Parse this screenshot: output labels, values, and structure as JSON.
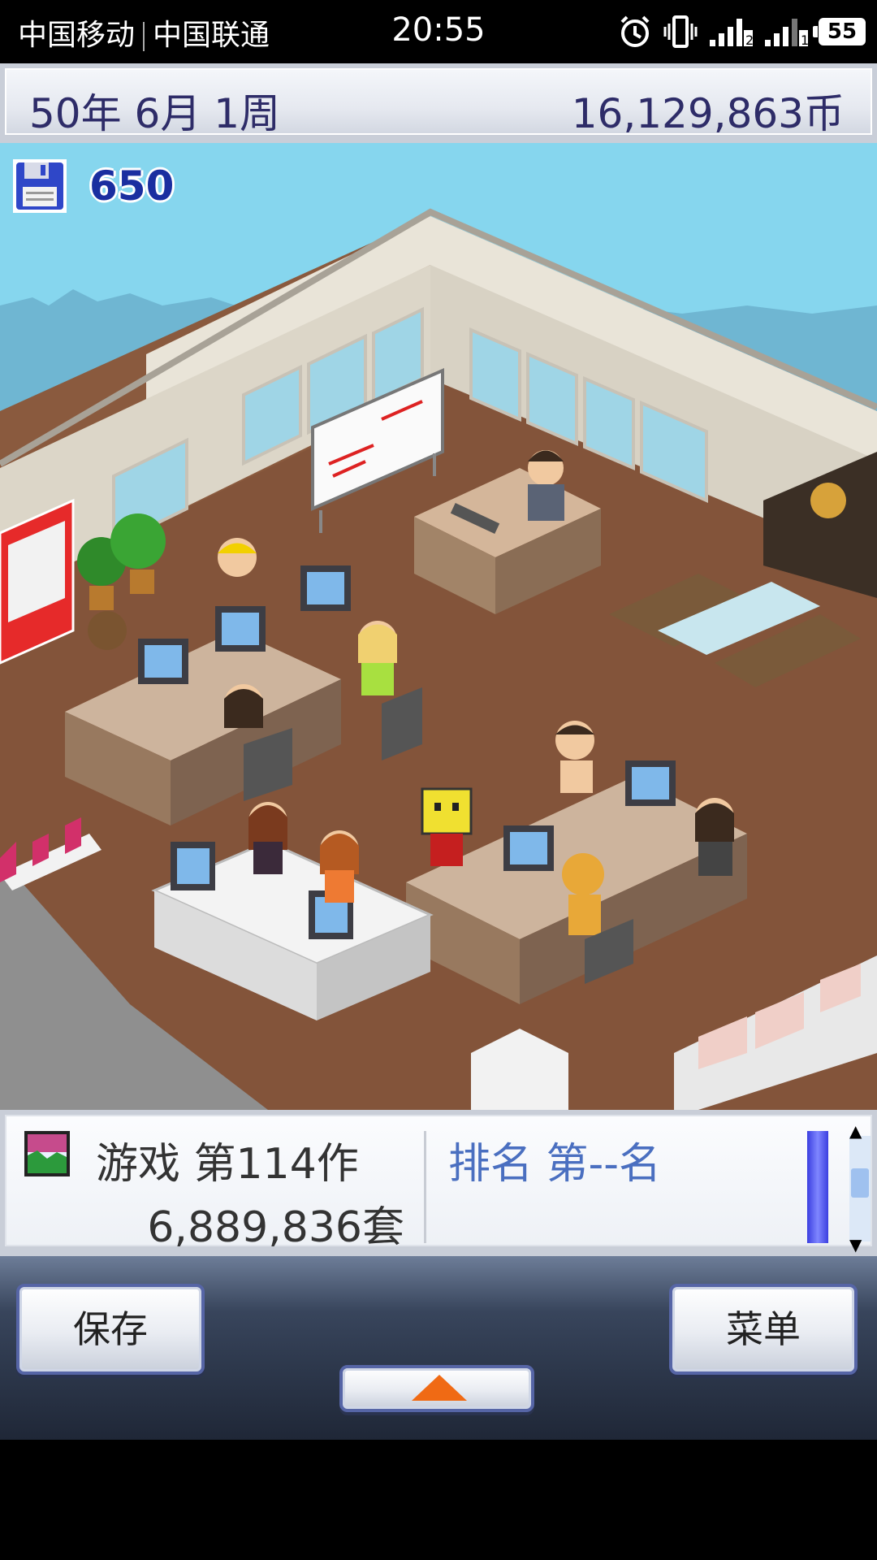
{
  "status_bar": {
    "carrier_1": "中国移动",
    "carrier_2": "中国联通",
    "time": "20:55",
    "battery": "55",
    "icons": [
      "alarm-icon",
      "vibrate-icon",
      "signal-2-icon",
      "signal-1-icon",
      "battery-icon"
    ]
  },
  "header": {
    "date": "50年 6月 1周",
    "money": "16,129,863币"
  },
  "hud": {
    "floppy_count": "650",
    "icon": "floppy-disk-icon"
  },
  "info_panel": {
    "game_title": "游戏 第114作",
    "sales": "6,889,836套",
    "rank": "排名 第--名",
    "icon": "game-cover-icon"
  },
  "buttons": {
    "save": "保存",
    "menu": "菜单",
    "expand_icon": "triangle-up-icon"
  },
  "colors": {
    "header_text": "#2e2c68",
    "rank_text": "#4a6fc0",
    "expand_arrow": "#f06a14",
    "rank_bar": "#3b3fe0"
  }
}
